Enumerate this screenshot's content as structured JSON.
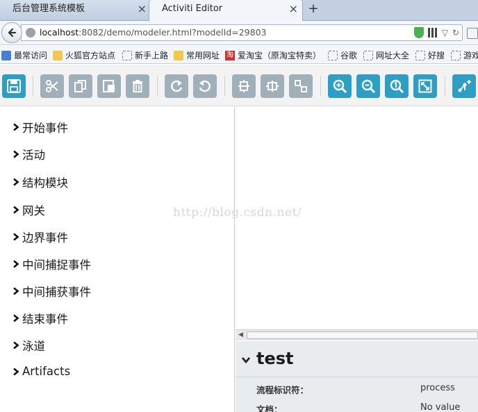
{
  "browser": {
    "tabs": [
      {
        "label": "后台管理系统模板",
        "active": false
      },
      {
        "label": "Activiti Editor",
        "active": true
      }
    ],
    "close_glyph": "×",
    "new_tab_glyph": "+",
    "url": {
      "host": "localhost",
      "rest": ":8082/demo/modeler.html?modelId=29803"
    },
    "bookmarks": [
      {
        "label": "最常访问",
        "icon": "bookmark-icon"
      },
      {
        "label": "火狐官方站点",
        "icon": "folder-icon"
      },
      {
        "label": "新手上路",
        "icon": "page-icon"
      },
      {
        "label": "常用网址",
        "icon": "folder-icon"
      },
      {
        "label": "爱淘宝（原淘宝特卖）",
        "icon": "taobao-icon",
        "icon_text": "淘"
      },
      {
        "label": "谷歌",
        "icon": "page-icon"
      },
      {
        "label": "网址大全",
        "icon": "page-icon"
      },
      {
        "label": "好搜",
        "icon": "page-icon"
      },
      {
        "label": "游戏",
        "icon": "page-icon"
      }
    ]
  },
  "toolbar": {
    "colors": {
      "primary": "#2f9ec4",
      "secondary": "#9fb0b9"
    },
    "buttons": [
      {
        "name": "save-button",
        "icon": "save-icon"
      },
      {
        "name": "cut-button",
        "icon": "scissors-icon"
      },
      {
        "name": "copy-button",
        "icon": "copy-icon"
      },
      {
        "name": "paste-button",
        "icon": "paste-icon"
      },
      {
        "name": "delete-button",
        "icon": "trash-icon"
      },
      {
        "name": "redo-button",
        "icon": "redo-icon"
      },
      {
        "name": "undo-button",
        "icon": "undo-icon"
      },
      {
        "name": "align-vertical-button",
        "icon": "align-vertical-icon"
      },
      {
        "name": "align-horizontal-button",
        "icon": "align-horizontal-icon"
      },
      {
        "name": "same-size-button",
        "icon": "same-size-icon"
      },
      {
        "name": "zoom-in-button",
        "icon": "zoom-in-icon"
      },
      {
        "name": "zoom-out-button",
        "icon": "zoom-out-icon"
      },
      {
        "name": "zoom-actual-button",
        "icon": "zoom-actual-icon"
      },
      {
        "name": "zoom-fit-button",
        "icon": "zoom-fit-icon"
      },
      {
        "name": "bend-point-button",
        "icon": "add-bendpoint-icon"
      }
    ]
  },
  "palette": {
    "groups": [
      "开始事件",
      "活动",
      "结构模块",
      "网关",
      "边界事件",
      "中间捕捉事件",
      "中间捕获事件",
      "结束事件",
      "泳道",
      "Artifacts"
    ]
  },
  "canvas": {
    "watermark": "http://blog.csdn.net/"
  },
  "properties": {
    "title": "test",
    "rows": [
      {
        "label": "流程标识符：",
        "value": "process"
      },
      {
        "label": "文档：",
        "value": "No value"
      }
    ]
  }
}
